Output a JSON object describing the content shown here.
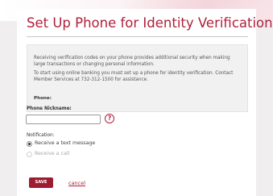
{
  "page": {
    "title": "Set Up Phone for Identity Verification"
  },
  "info": {
    "paragraph_1": "Receiving verification codes on your phone provides additional security when making large transactions or changing personal information.",
    "paragraph_2": "To start using online banking you must set up a phone for identity verification. Contact Member Services at 732-312-1500 for assistance.",
    "phone_label": "Phone:"
  },
  "form": {
    "nickname_label": "Phone Nickname:",
    "nickname_value": "",
    "help_icon_glyph": "?",
    "notification_label": "Notification:",
    "options": [
      {
        "label": "Receive a text message",
        "selected": true
      },
      {
        "label": "Receive a call",
        "selected": false
      }
    ]
  },
  "actions": {
    "save_label": "SAVE",
    "cancel_label": "cancel"
  },
  "colors": {
    "accent": "#b01f3a",
    "button": "#9e1c30"
  }
}
